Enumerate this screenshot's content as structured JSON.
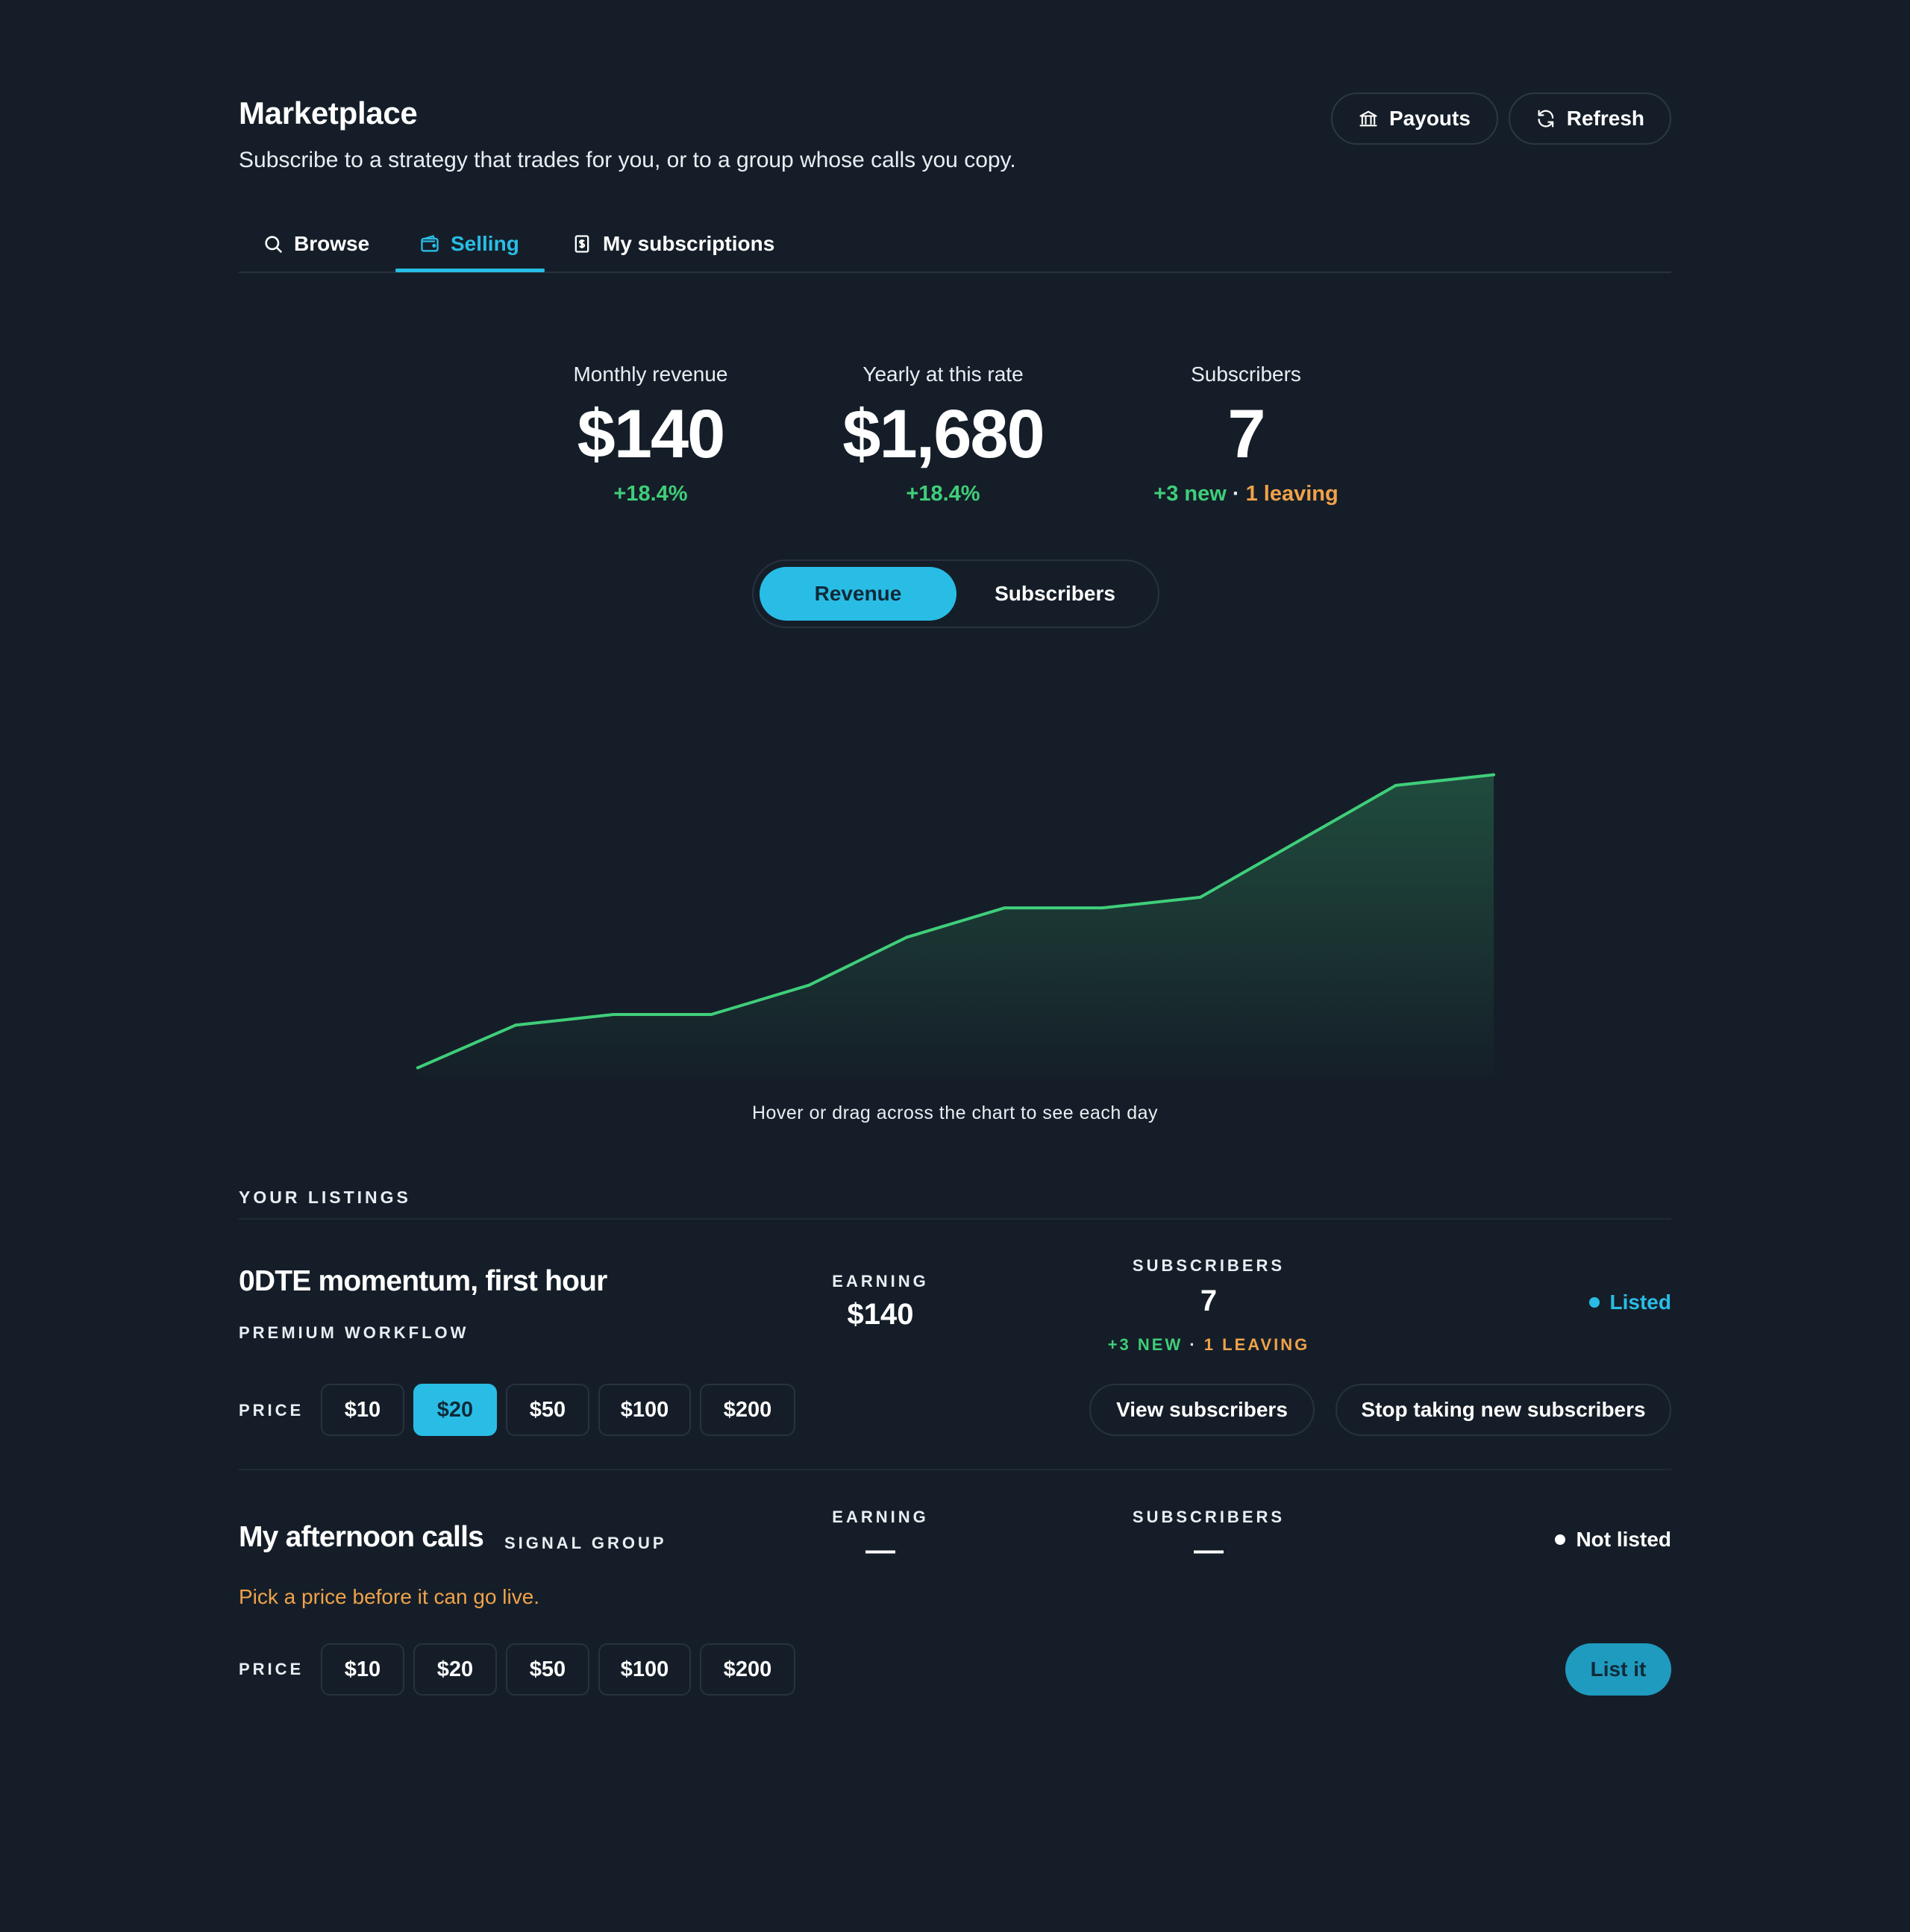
{
  "header": {
    "title": "Marketplace",
    "subtitle": "Subscribe to a strategy that trades for you, or to a group whose calls you copy.",
    "payouts_label": "Payouts",
    "refresh_label": "Refresh"
  },
  "tabs": [
    {
      "label": "Browse",
      "icon": "search-icon"
    },
    {
      "label": "Selling",
      "icon": "wallet-icon",
      "active": true
    },
    {
      "label": "My subscriptions",
      "icon": "receipt-icon"
    }
  ],
  "stats": {
    "monthly": {
      "label": "Monthly revenue",
      "value": "$140",
      "delta": "+18.4%"
    },
    "yearly": {
      "label": "Yearly at this rate",
      "value": "$1,680",
      "delta": "+18.4%"
    },
    "subscribers": {
      "label": "Subscribers",
      "value": "7",
      "new": "+3 new",
      "sep": "·",
      "leaving": "1 leaving"
    }
  },
  "toggle": {
    "revenue_label": "Revenue",
    "subscribers_label": "Subscribers",
    "selected": "Revenue"
  },
  "chart_data": {
    "type": "area",
    "x": [
      1,
      2,
      3,
      4,
      5,
      6,
      7,
      8,
      9,
      10,
      11,
      12
    ],
    "values": [
      8,
      24,
      28,
      28,
      39,
      57,
      68,
      68,
      72,
      93,
      114,
      118
    ],
    "ylim": [
      0,
      140
    ],
    "grid": false,
    "color": "#3fce7a"
  },
  "chart_hint": "Hover or drag across the chart to see each day",
  "listings": {
    "section_title": "YOUR LISTINGS",
    "items": [
      {
        "title": "0DTE momentum, first hour",
        "kind": "PREMIUM WORKFLOW",
        "earning_label": "EARNING",
        "earning": "$140",
        "subscribers_label": "SUBSCRIBERS",
        "subscribers": "7",
        "subs_new": "+3 NEW",
        "subs_sep": "·",
        "subs_leaving": "1 LEAVING",
        "status": "Listed",
        "price_label": "PRICE",
        "prices": [
          "$10",
          "$20",
          "$50",
          "$100",
          "$200"
        ],
        "selected_price": "$20",
        "view_subscribers_label": "View subscribers",
        "stop_label": "Stop taking new subscribers"
      },
      {
        "title": "My afternoon calls",
        "kind": "SIGNAL GROUP",
        "earning_label": "EARNING",
        "earning": "—",
        "subscribers_label": "SUBSCRIBERS",
        "subscribers": "—",
        "status": "Not listed",
        "warning": "Pick a price before it can go live.",
        "price_label": "PRICE",
        "prices": [
          "$10",
          "$20",
          "$50",
          "$100",
          "$200"
        ],
        "list_label": "List it"
      }
    ]
  },
  "colors": {
    "accent": "#29bde6",
    "positive": "#3fce7a",
    "warning": "#f0a24a",
    "background": "#151e28"
  }
}
